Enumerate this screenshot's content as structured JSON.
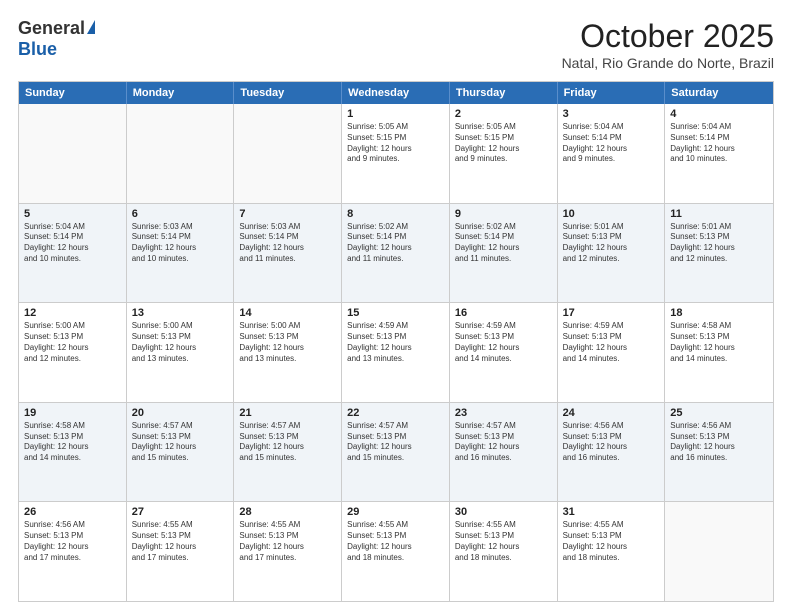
{
  "logo": {
    "general": "General",
    "blue": "Blue"
  },
  "title": "October 2025",
  "subtitle": "Natal, Rio Grande do Norte, Brazil",
  "headers": [
    "Sunday",
    "Monday",
    "Tuesday",
    "Wednesday",
    "Thursday",
    "Friday",
    "Saturday"
  ],
  "rows": [
    [
      {
        "day": "",
        "lines": [],
        "empty": true
      },
      {
        "day": "",
        "lines": [],
        "empty": true
      },
      {
        "day": "",
        "lines": [],
        "empty": true
      },
      {
        "day": "1",
        "lines": [
          "Sunrise: 5:05 AM",
          "Sunset: 5:15 PM",
          "Daylight: 12 hours",
          "and 9 minutes."
        ],
        "empty": false
      },
      {
        "day": "2",
        "lines": [
          "Sunrise: 5:05 AM",
          "Sunset: 5:15 PM",
          "Daylight: 12 hours",
          "and 9 minutes."
        ],
        "empty": false
      },
      {
        "day": "3",
        "lines": [
          "Sunrise: 5:04 AM",
          "Sunset: 5:14 PM",
          "Daylight: 12 hours",
          "and 9 minutes."
        ],
        "empty": false
      },
      {
        "day": "4",
        "lines": [
          "Sunrise: 5:04 AM",
          "Sunset: 5:14 PM",
          "Daylight: 12 hours",
          "and 10 minutes."
        ],
        "empty": false
      }
    ],
    [
      {
        "day": "5",
        "lines": [
          "Sunrise: 5:04 AM",
          "Sunset: 5:14 PM",
          "Daylight: 12 hours",
          "and 10 minutes."
        ],
        "empty": false
      },
      {
        "day": "6",
        "lines": [
          "Sunrise: 5:03 AM",
          "Sunset: 5:14 PM",
          "Daylight: 12 hours",
          "and 10 minutes."
        ],
        "empty": false
      },
      {
        "day": "7",
        "lines": [
          "Sunrise: 5:03 AM",
          "Sunset: 5:14 PM",
          "Daylight: 12 hours",
          "and 11 minutes."
        ],
        "empty": false
      },
      {
        "day": "8",
        "lines": [
          "Sunrise: 5:02 AM",
          "Sunset: 5:14 PM",
          "Daylight: 12 hours",
          "and 11 minutes."
        ],
        "empty": false
      },
      {
        "day": "9",
        "lines": [
          "Sunrise: 5:02 AM",
          "Sunset: 5:14 PM",
          "Daylight: 12 hours",
          "and 11 minutes."
        ],
        "empty": false
      },
      {
        "day": "10",
        "lines": [
          "Sunrise: 5:01 AM",
          "Sunset: 5:13 PM",
          "Daylight: 12 hours",
          "and 12 minutes."
        ],
        "empty": false
      },
      {
        "day": "11",
        "lines": [
          "Sunrise: 5:01 AM",
          "Sunset: 5:13 PM",
          "Daylight: 12 hours",
          "and 12 minutes."
        ],
        "empty": false
      }
    ],
    [
      {
        "day": "12",
        "lines": [
          "Sunrise: 5:00 AM",
          "Sunset: 5:13 PM",
          "Daylight: 12 hours",
          "and 12 minutes."
        ],
        "empty": false
      },
      {
        "day": "13",
        "lines": [
          "Sunrise: 5:00 AM",
          "Sunset: 5:13 PM",
          "Daylight: 12 hours",
          "and 13 minutes."
        ],
        "empty": false
      },
      {
        "day": "14",
        "lines": [
          "Sunrise: 5:00 AM",
          "Sunset: 5:13 PM",
          "Daylight: 12 hours",
          "and 13 minutes."
        ],
        "empty": false
      },
      {
        "day": "15",
        "lines": [
          "Sunrise: 4:59 AM",
          "Sunset: 5:13 PM",
          "Daylight: 12 hours",
          "and 13 minutes."
        ],
        "empty": false
      },
      {
        "day": "16",
        "lines": [
          "Sunrise: 4:59 AM",
          "Sunset: 5:13 PM",
          "Daylight: 12 hours",
          "and 14 minutes."
        ],
        "empty": false
      },
      {
        "day": "17",
        "lines": [
          "Sunrise: 4:59 AM",
          "Sunset: 5:13 PM",
          "Daylight: 12 hours",
          "and 14 minutes."
        ],
        "empty": false
      },
      {
        "day": "18",
        "lines": [
          "Sunrise: 4:58 AM",
          "Sunset: 5:13 PM",
          "Daylight: 12 hours",
          "and 14 minutes."
        ],
        "empty": false
      }
    ],
    [
      {
        "day": "19",
        "lines": [
          "Sunrise: 4:58 AM",
          "Sunset: 5:13 PM",
          "Daylight: 12 hours",
          "and 14 minutes."
        ],
        "empty": false
      },
      {
        "day": "20",
        "lines": [
          "Sunrise: 4:57 AM",
          "Sunset: 5:13 PM",
          "Daylight: 12 hours",
          "and 15 minutes."
        ],
        "empty": false
      },
      {
        "day": "21",
        "lines": [
          "Sunrise: 4:57 AM",
          "Sunset: 5:13 PM",
          "Daylight: 12 hours",
          "and 15 minutes."
        ],
        "empty": false
      },
      {
        "day": "22",
        "lines": [
          "Sunrise: 4:57 AM",
          "Sunset: 5:13 PM",
          "Daylight: 12 hours",
          "and 15 minutes."
        ],
        "empty": false
      },
      {
        "day": "23",
        "lines": [
          "Sunrise: 4:57 AM",
          "Sunset: 5:13 PM",
          "Daylight: 12 hours",
          "and 16 minutes."
        ],
        "empty": false
      },
      {
        "day": "24",
        "lines": [
          "Sunrise: 4:56 AM",
          "Sunset: 5:13 PM",
          "Daylight: 12 hours",
          "and 16 minutes."
        ],
        "empty": false
      },
      {
        "day": "25",
        "lines": [
          "Sunrise: 4:56 AM",
          "Sunset: 5:13 PM",
          "Daylight: 12 hours",
          "and 16 minutes."
        ],
        "empty": false
      }
    ],
    [
      {
        "day": "26",
        "lines": [
          "Sunrise: 4:56 AM",
          "Sunset: 5:13 PM",
          "Daylight: 12 hours",
          "and 17 minutes."
        ],
        "empty": false
      },
      {
        "day": "27",
        "lines": [
          "Sunrise: 4:55 AM",
          "Sunset: 5:13 PM",
          "Daylight: 12 hours",
          "and 17 minutes."
        ],
        "empty": false
      },
      {
        "day": "28",
        "lines": [
          "Sunrise: 4:55 AM",
          "Sunset: 5:13 PM",
          "Daylight: 12 hours",
          "and 17 minutes."
        ],
        "empty": false
      },
      {
        "day": "29",
        "lines": [
          "Sunrise: 4:55 AM",
          "Sunset: 5:13 PM",
          "Daylight: 12 hours",
          "and 18 minutes."
        ],
        "empty": false
      },
      {
        "day": "30",
        "lines": [
          "Sunrise: 4:55 AM",
          "Sunset: 5:13 PM",
          "Daylight: 12 hours",
          "and 18 minutes."
        ],
        "empty": false
      },
      {
        "day": "31",
        "lines": [
          "Sunrise: 4:55 AM",
          "Sunset: 5:13 PM",
          "Daylight: 12 hours",
          "and 18 minutes."
        ],
        "empty": false
      },
      {
        "day": "",
        "lines": [],
        "empty": true
      }
    ]
  ]
}
